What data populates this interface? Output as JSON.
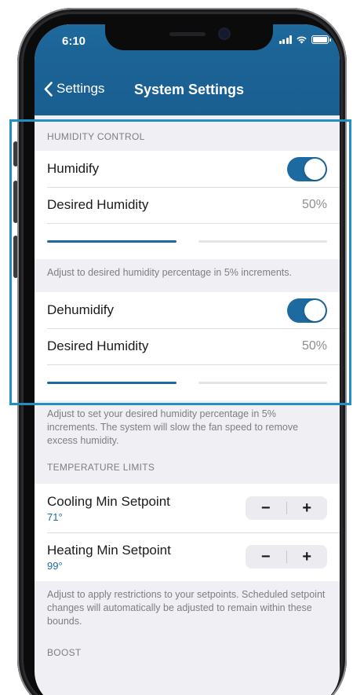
{
  "status_bar": {
    "time": "6:10"
  },
  "nav": {
    "back_label": "Settings",
    "title": "System Settings"
  },
  "humidity_control": {
    "header": "HUMIDITY CONTROL",
    "humidify": {
      "label": "Humidify",
      "enabled": true
    },
    "humidify_desired": {
      "label": "Desired Humidity",
      "value": "50%",
      "level": 0.5
    },
    "humidify_note": "Adjust to desired humidity percentage in 5% increments.",
    "dehumidify": {
      "label": "Dehumidify",
      "enabled": true
    },
    "dehumidify_desired": {
      "label": "Desired Humidity",
      "value": "50%",
      "level": 0.5
    },
    "dehumidify_note": "Adjust to set your desired humidity percentage in 5% increments. The system will slow the fan speed to remove excess humidity."
  },
  "temperature_limits": {
    "header": "TEMPERATURE LIMITS",
    "cooling": {
      "label": "Cooling Min Setpoint",
      "value": "71°"
    },
    "heating": {
      "label": "Heating Min Setpoint",
      "value": "99°"
    },
    "minus": "−",
    "plus": "+",
    "note": "Adjust to apply restrictions to your setpoints. Scheduled setpoint changes will automatically be adjusted to remain within these bounds."
  },
  "boost": {
    "header": "BOOST"
  },
  "colors": {
    "accent": "#1c6aa0",
    "header_bg": "#1a5f90",
    "highlight": "#1f8fc4"
  }
}
